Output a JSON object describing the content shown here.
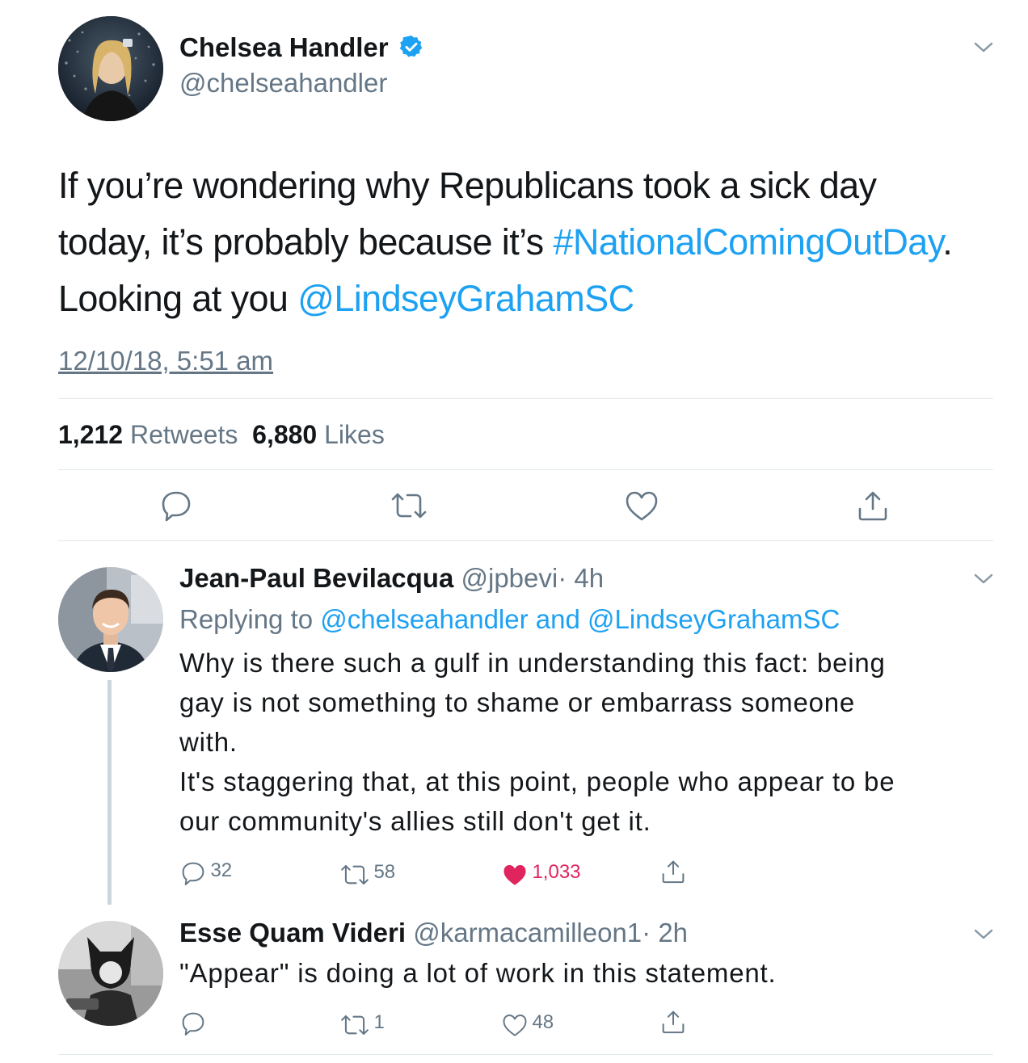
{
  "tweet": {
    "author_name": "Chelsea Handler",
    "author_handle": "@chelseahandler",
    "text_line1": "If you’re wondering why Republicans took a sick day",
    "text_line2_plain": "today, it’s probably because it’s ",
    "text_line2_hashtag": "#NationalComingOutDay",
    "text_line2_end": ".",
    "text_line3_plain": "Looking at you ",
    "text_line3_mention": "@LindseyGrahamSC",
    "timestamp": "12/10/18, 5:51 am",
    "retweets_count": "1,212",
    "retweets_label": "Retweets",
    "likes_count": "6,880",
    "likes_label": "Likes"
  },
  "replies": [
    {
      "author_name": "Jean-Paul Bevilacqua",
      "author_handle": "@jpbevi",
      "time": "· 4h",
      "replying_label": "Replying to",
      "replying_to_1": "@chelseahandler",
      "replying_and": "and",
      "replying_to_2": "@LindseyGrahamSC",
      "lines": [
        "Why is there such a gulf in understanding this fact: being",
        "gay is not something to shame or embarrass someone",
        "with.",
        "It's staggering that, at this point, people who appear to be",
        "our community's allies still don't get it."
      ],
      "replies_count": "32",
      "retweets_count": "58",
      "likes_count": "1,033",
      "liked": true
    },
    {
      "author_name": "Esse Quam Videri",
      "author_handle": "@karmacamilleon1",
      "time": "· 2h",
      "lines": [
        "\"Appear\" is doing a lot of work in this statement."
      ],
      "replies_count": "",
      "retweets_count": "1",
      "likes_count": "48",
      "liked": false
    }
  ],
  "colors": {
    "link": "#1da1f2",
    "secondary_text": "#657786",
    "like_active": "#e0245e",
    "divider": "#e1e8ed"
  },
  "icons": [
    "verified-badge-icon",
    "chevron-down-icon",
    "reply-icon",
    "retweet-icon",
    "like-icon",
    "share-icon"
  ]
}
